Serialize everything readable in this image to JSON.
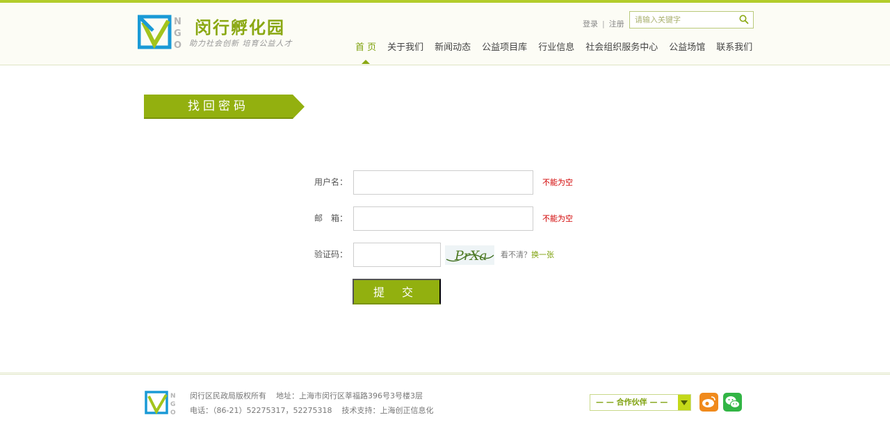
{
  "header": {
    "logo_title": "闵行孵化园",
    "logo_slogan": "助力社会创新 培育公益人才",
    "logo_letters": "NGO",
    "login_label": "登录",
    "separator": "|",
    "register_label": "注册",
    "search_placeholder": "请输入关键字"
  },
  "nav": {
    "items": [
      {
        "label": "首 页",
        "active": true
      },
      {
        "label": "关于我们",
        "active": false
      },
      {
        "label": "新闻动态",
        "active": false
      },
      {
        "label": "公益项目库",
        "active": false
      },
      {
        "label": "行业信息",
        "active": false
      },
      {
        "label": "社会组织服务中心",
        "active": false
      },
      {
        "label": "公益场馆",
        "active": false
      },
      {
        "label": "联系我们",
        "active": false
      }
    ]
  },
  "page": {
    "title": "找回密码"
  },
  "form": {
    "username_label": "用户名：",
    "username_error": "不能为空",
    "email_label": "邮　箱：",
    "email_error": "不能为空",
    "captcha_label": "验证码：",
    "captcha_text": "PrXa",
    "captcha_unclear": "看不清？",
    "captcha_refresh": "换一张",
    "submit_label": "提 交"
  },
  "footer": {
    "copyright": "闵行区民政局版权所有",
    "address": "地址：上海市闵行区莘福路396号3号楼3层",
    "phone": "电话：（86-21）52275317，52275318",
    "tech_support": "技术支持：上海创正信息化",
    "partner_label": "— — 合作伙伴 — —"
  },
  "colors": {
    "brand_green": "#8aa812",
    "top_bar": "#b3cc2b",
    "button_green": "#92b00f",
    "error_red": "#d10000",
    "weibo_orange": "#f08a1c",
    "wechat_green": "#32b545"
  },
  "icons": [
    "ngo-logo-icon",
    "search-icon",
    "chevron-down-icon",
    "weibo-icon",
    "wechat-icon"
  ]
}
